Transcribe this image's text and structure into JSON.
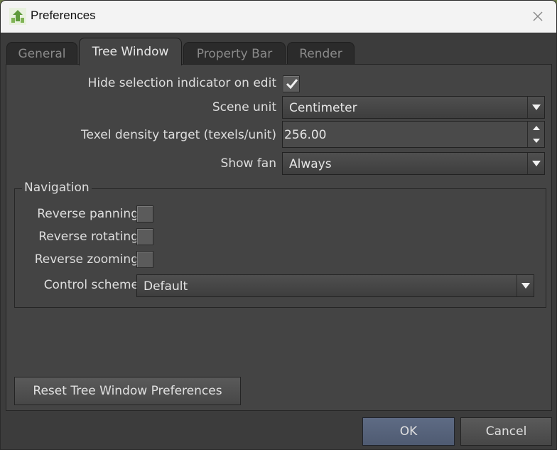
{
  "window": {
    "title": "Preferences"
  },
  "tabs": [
    {
      "label": "General"
    },
    {
      "label": "Tree Window"
    },
    {
      "label": "Property Bar"
    },
    {
      "label": "Render"
    }
  ],
  "active_tab": "Tree Window",
  "settings": {
    "hide_selection": {
      "label": "Hide selection indicator on edit",
      "checked": true
    },
    "scene_unit": {
      "label": "Scene unit",
      "value": "Centimeter"
    },
    "texel_density": {
      "label": "Texel density target (texels/unit)",
      "value": "256.00"
    },
    "show_fan": {
      "label": "Show fan",
      "value": "Always"
    }
  },
  "navigation": {
    "title": "Navigation",
    "reverse_panning": {
      "label": "Reverse panning",
      "checked": false
    },
    "reverse_rotating": {
      "label": "Reverse rotating",
      "checked": false
    },
    "reverse_zooming": {
      "label": "Reverse zooming",
      "checked": false
    },
    "control_scheme": {
      "label": "Control scheme",
      "value": "Default"
    }
  },
  "buttons": {
    "reset": "Reset Tree Window Preferences",
    "ok": "OK",
    "cancel": "Cancel"
  },
  "icons": {
    "app": "app-tree-icon",
    "close": "close-icon",
    "dropdown": "chevron-down-icon",
    "check": "checkmark-icon"
  }
}
